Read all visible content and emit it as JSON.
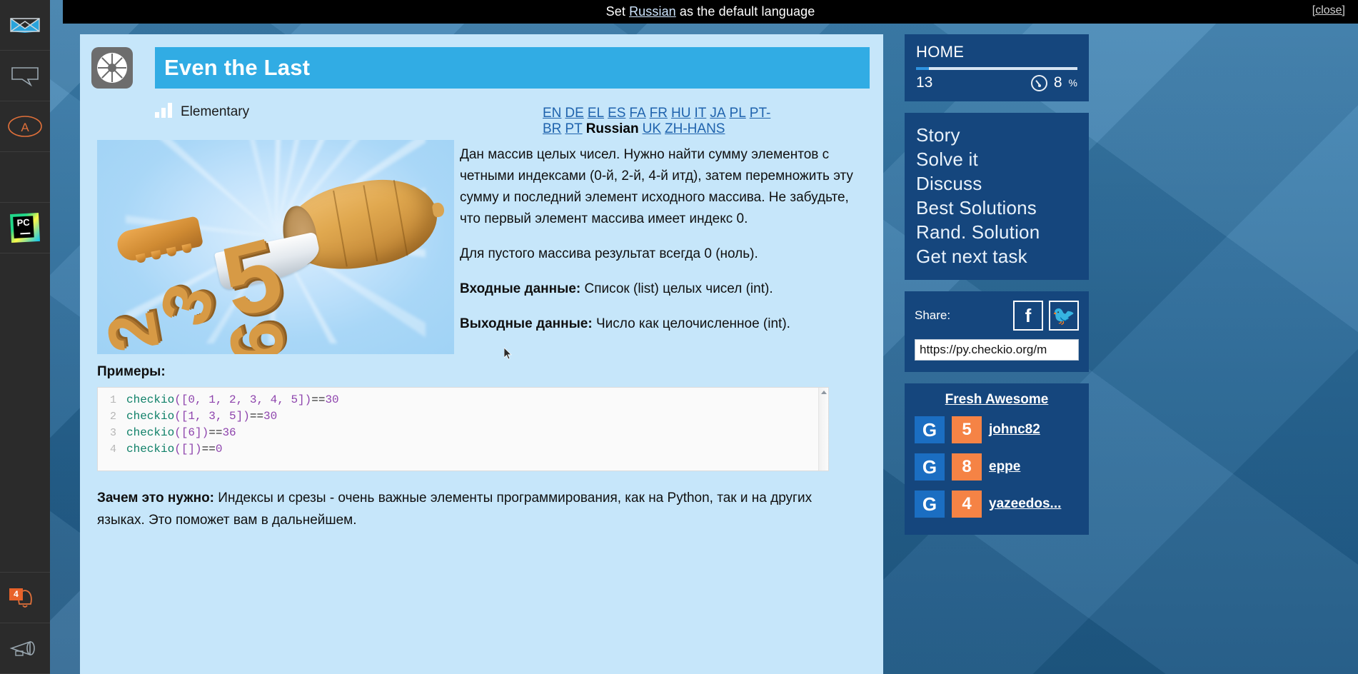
{
  "dock": {
    "items": [
      {
        "name": "mail-icon",
        "label": "Mail"
      },
      {
        "name": "chat-icon",
        "label": "Chat"
      },
      {
        "name": "avatar-icon",
        "label": "A"
      },
      {
        "name": "pycharm-icon",
        "label": "PC"
      },
      {
        "name": "bell-icon",
        "label": "Notifications",
        "badge": "4"
      },
      {
        "name": "megaphone-icon",
        "label": "Announcements"
      }
    ]
  },
  "topbar": {
    "prefix": "Set ",
    "link": "Russian",
    "suffix": " as the default language",
    "close_label": "[close]"
  },
  "task": {
    "title": "Even the Last",
    "difficulty": "Elementary",
    "languages": [
      "EN",
      "DE",
      "EL",
      "ES",
      "FA",
      "FR",
      "HU",
      "IT",
      "JA",
      "PL",
      "PT-BR",
      "PT"
    ],
    "current_language": "Russian",
    "languages_after": [
      "UK",
      "ZH-HANS"
    ],
    "description": [
      "Дан массив целых чисел. Нужно найти сумму элементов с четными индексами (0-й, 2-й, 4-й итд), затем перемножить эту сумму и последний элемент исходного массива. Не забудьте, что первый элемент массива имеет индекс 0.",
      "Для пустого массива результат всегда 0 (ноль)."
    ],
    "input_label": "Входные данные:",
    "input_text": " Список (list) целых чисел (int).",
    "output_label": "Выходные данные:",
    "output_text": " Число как целочисленное (int).",
    "examples_label": "Примеры:",
    "code_lines": [
      {
        "n": "1",
        "fn": "checkio",
        "args": "([0, 1, 2, 3, 4, 5])",
        "op": " == ",
        "result": "30"
      },
      {
        "n": "2",
        "fn": "checkio",
        "args": "([1, 3, 5])",
        "op": " == ",
        "result": "30"
      },
      {
        "n": "3",
        "fn": "checkio",
        "args": "([6])",
        "op": " == ",
        "result": "36"
      },
      {
        "n": "4",
        "fn": "checkio",
        "args": "([])",
        "op": " == ",
        "result": "0"
      }
    ],
    "why_label": "Зачем это нужно:",
    "why_text": " Индексы и срезы - очень важные элементы программирования, как на Python, так и на других языках. Это поможет вам в дальнейшем."
  },
  "rail": {
    "home": {
      "title": "HOME",
      "level": "13",
      "percent": "8",
      "percent_symbol": "%",
      "progress_value": 8
    },
    "nav": [
      {
        "label": "Story"
      },
      {
        "label": "Solve it"
      },
      {
        "label": "Discuss"
      },
      {
        "label": "Best Solutions"
      },
      {
        "label": "Rand. Solution"
      },
      {
        "label": "Get next task"
      }
    ],
    "share": {
      "label": "Share:",
      "facebook": "f",
      "twitter": "🐦",
      "url": "https://py.checkio.org/m"
    },
    "fresh": {
      "title": "Fresh Awesome",
      "rows": [
        {
          "icon": "G",
          "count": "5",
          "user": "johnc82"
        },
        {
          "icon": "G",
          "count": "8",
          "user": "eppe"
        },
        {
          "icon": "G",
          "count": "4",
          "user": "yazeedos..."
        }
      ]
    }
  },
  "colors": {
    "accent": "#31ace4",
    "panel": "#15467d",
    "badge": "#f58345",
    "card": "#c6e6fa"
  },
  "illustration": {
    "digits": [
      "5",
      "3",
      "2",
      "6"
    ]
  }
}
